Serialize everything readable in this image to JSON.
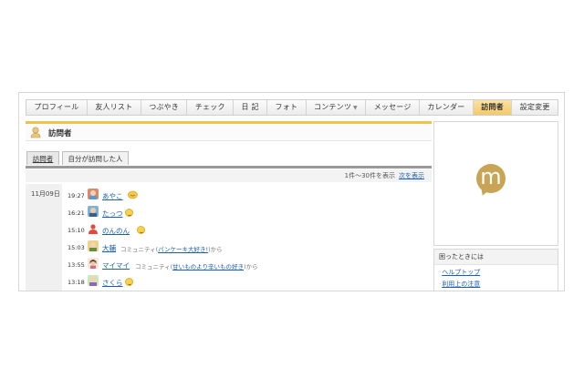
{
  "nav": {
    "items": [
      {
        "label": "プロフィール"
      },
      {
        "label": "友人リスト"
      },
      {
        "label": "つぶやき"
      },
      {
        "label": "チェック"
      },
      {
        "label": "日 記"
      },
      {
        "label": "フォト"
      },
      {
        "label": "コンテンツ"
      },
      {
        "label": "メッセージ"
      },
      {
        "label": "カレンダー"
      },
      {
        "label": "訪問者"
      },
      {
        "label": "設定変更"
      }
    ],
    "dropdown_arrow": "▼",
    "active": "訪問者",
    "active_color": "#f4c96a"
  },
  "page": {
    "title": "訪問者",
    "title_icon": "visitor-person-icon",
    "accent_color": "#f0c14b"
  },
  "tabs": [
    {
      "label": "訪問者"
    },
    {
      "label": "自分が訪問した人"
    }
  ],
  "pager": {
    "range_text": "1件〜30件を表示",
    "next_label": "次を表示"
  },
  "visits": {
    "date": "11月09日",
    "entries": [
      {
        "time": "19:27",
        "name": "あやこ",
        "note": "",
        "note_prefix": "",
        "note_link": "",
        "note_suffix": ""
      },
      {
        "time": "16:21",
        "name": "たっつ",
        "note_prefix": "",
        "note_link": "",
        "note_suffix": ""
      },
      {
        "time": "15:10",
        "name": "のんのん",
        "note_prefix": "",
        "note_link": "",
        "note_suffix": ""
      },
      {
        "time": "15:03",
        "name": "大輔",
        "note_prefix": "コミュニティ(",
        "note_link": "パンケーキ大好き!",
        "note_suffix": ")から"
      },
      {
        "time": "13:55",
        "name": "マイマイ",
        "note_prefix": "コミュニティ(",
        "note_link": "甘いものより辛いもの好き",
        "note_suffix": ")から"
      },
      {
        "time": "13:18",
        "name": "さくら",
        "note_prefix": "",
        "note_link": "",
        "note_suffix": ""
      }
    ]
  },
  "ad": {
    "logo_letter": "m",
    "logo_color": "#c8a455"
  },
  "help": {
    "title": "困ったときには",
    "links": [
      {
        "label": "ヘルプトップ"
      },
      {
        "label": "利用上の注意"
      }
    ]
  }
}
